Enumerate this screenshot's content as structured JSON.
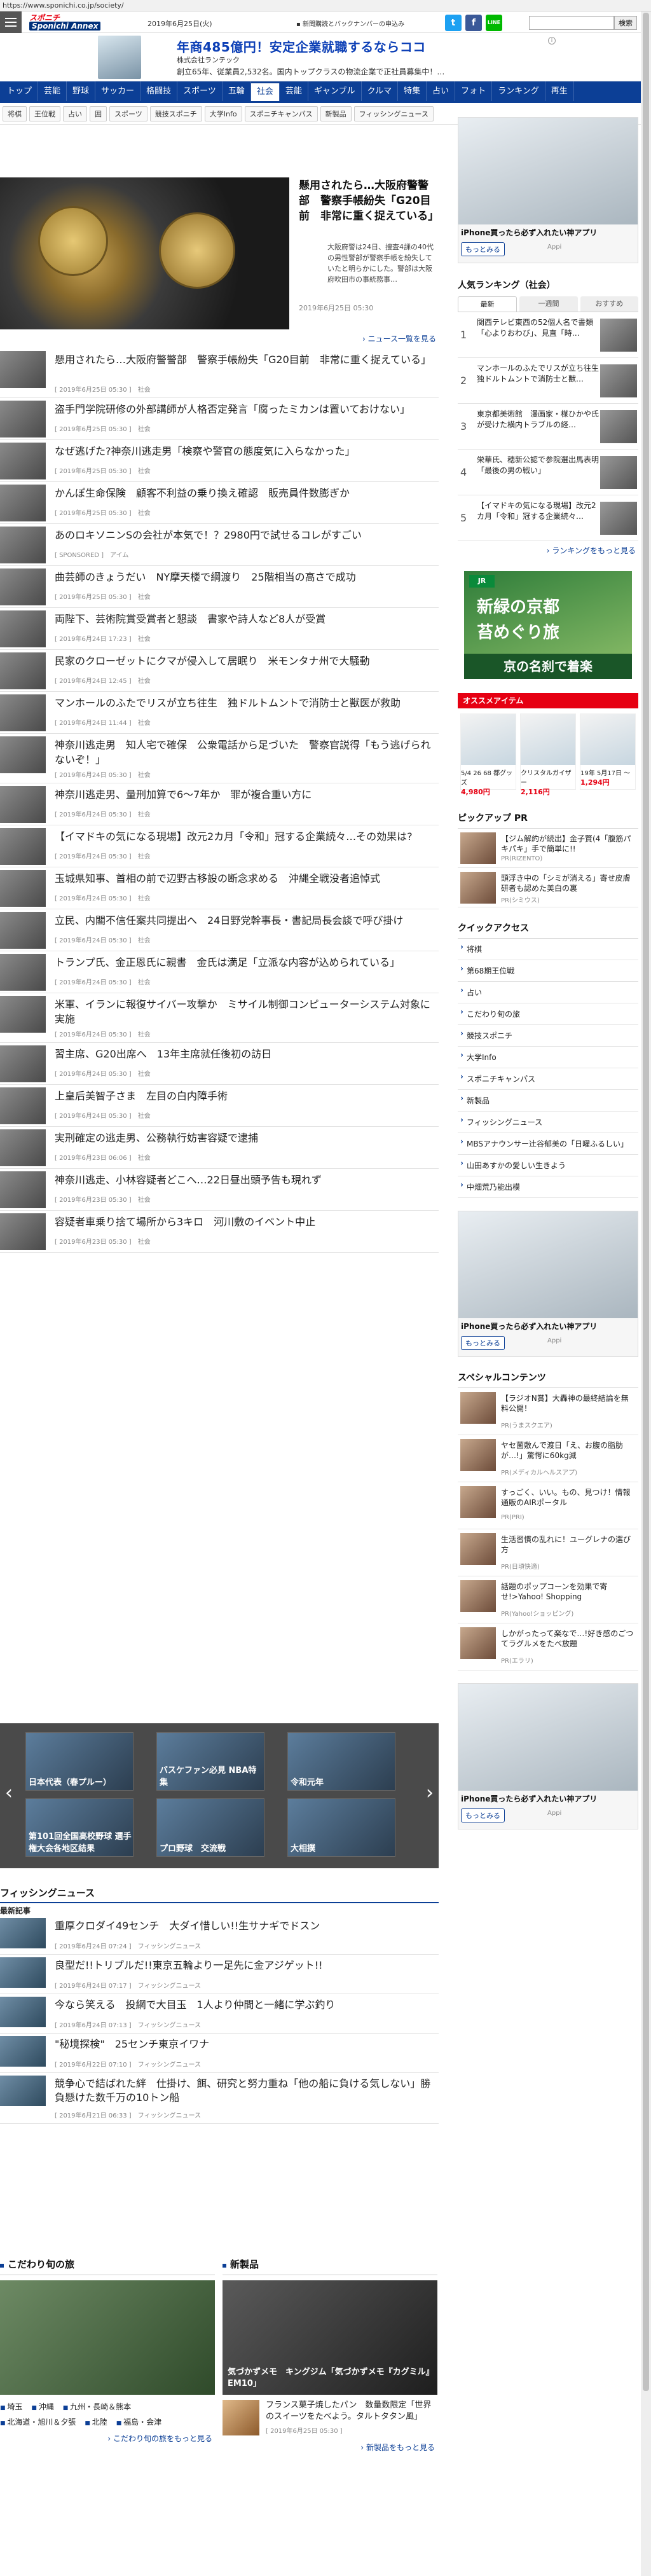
{
  "browser": {
    "url": "https://www.sponichi.co.jp/society/"
  },
  "header": {
    "logo_line1": "スポニチ",
    "logo_line2": "Sponichi Annex",
    "date": "2019年6月25日(火)",
    "subscribe": "新聞購読とバックナンバーの申込み",
    "search_button": "検索",
    "line_label": "LINE"
  },
  "top_ad": {
    "headline": "年商485億円！安定企業就職するならココ",
    "company": "株式会社ランテック",
    "body": "創立65年、従業員2,532名。国内トップクラスの物流企業で正社員募集中！…"
  },
  "nav": {
    "items": [
      "トップ",
      "芸能",
      "野球",
      "サッカー",
      "格闘技",
      "スポーツ",
      "五輪",
      "社会",
      "芸能",
      "ギャンブル",
      "クルマ",
      "特集",
      "占い",
      "フォト",
      "ランキング",
      "再生"
    ],
    "active_index": 7
  },
  "subnav": {
    "items": [
      "将棋",
      "王位戦",
      "占い",
      "囲",
      "スポーツ",
      "競技スポニチ",
      "大学Info",
      "スポニチキャンパス",
      "新製品",
      "フィッシングニュース"
    ]
  },
  "feature": {
    "title": "懸用されたら…大阪府警警部　警察手帳紛失「G20目前　非常に重く捉えている」",
    "desc": "大阪府警は24日、捜査4課の40代の男性警部が警察手帳を紛失していたと明らかにした。警部は大阪府吹田市の事統務事…",
    "date": "2019年6月25日 05:30",
    "more": "ニュース一覧を見る"
  },
  "articles": [
    {
      "title": "懸用されたら…大阪府警警部　警察手帳紛失「G20目前　非常に重く捉えている」",
      "meta": "[ 2019年6月25日 05:30 ]　社会"
    },
    {
      "title": "盗手門学院研修の外部講師が人格否定発言「腐ったミカンは置いておけない」",
      "meta": "[ 2019年6月25日 05:30 ]　社会"
    },
    {
      "title": "なぜ逃げた?神奈川逃走男「検察や警官の態度気に入らなかった」",
      "meta": "[ 2019年6月25日 05:30 ]　社会"
    },
    {
      "title": "かんぽ生命保険　顧客不利益の乗り換え確認　販売員件数膨ぎか",
      "meta": "[ 2019年6月25日 05:30 ]　社会"
    },
    {
      "title": "あのロキソニンSの会社が本気で！？2980円で試せるコレがすごい",
      "meta": "[ SPONSORED ]　アイム"
    },
    {
      "title": "曲芸師のきょうだい　NY摩天楼で綱渡り　25階相当の高さで成功",
      "meta": "[ 2019年6月25日 05:30 ]　社会"
    },
    {
      "title": "両陛下、芸術院賞受賞者と懇談　書家や詩人など8人が受賞",
      "meta": "[ 2019年6月24日 17:23 ]　社会"
    },
    {
      "title": "民家のクローゼットにクマが侵入して居眠り　米モンタナ州で大騒動",
      "meta": "[ 2019年6月24日 12:45 ]　社会"
    },
    {
      "title": "マンホールのふたでリスが立ち往生　独ドルトムントで消防士と獣医が救助",
      "meta": "[ 2019年6月24日 11:44 ]　社会"
    },
    {
      "title": "神奈川逃走男　知人宅で確保　公衆電話から足づいた　警察官説得「もう逃げられないぞ！」",
      "meta": "[ 2019年6月24日 05:30 ]　社会"
    },
    {
      "title": "神奈川逃走男、量刑加算で6～7年か　罪が複合重い方に",
      "meta": "[ 2019年6月24日 05:30 ]　社会"
    },
    {
      "title": "【イマドキの気になる現場】改元2カ月「令和」冠する企業続々…その効果は?",
      "meta": "[ 2019年6月24日 05:30 ]　社会"
    },
    {
      "title": "玉城県知事、首相の前で辺野古移設の断念求める　沖縄全戦没者追悼式",
      "meta": "[ 2019年6月24日 05:30 ]　社会"
    },
    {
      "title": "立民、内閣不信任案共同提出へ　24日野党幹事長・書記局長会談で呼び掛け",
      "meta": "[ 2019年6月24日 05:30 ]　社会"
    },
    {
      "title": "トランプ氏、金正恩氏に親書　金氏は満足「立派な内容が込められている」",
      "meta": "[ 2019年6月24日 05:30 ]　社会"
    },
    {
      "title": "米軍、イランに報復サイバー攻撃か　ミサイル制御コンピューターシステム対象に実施",
      "meta": "[ 2019年6月24日 05:30 ]　社会"
    },
    {
      "title": "習主席、G20出席へ　13年主席就任後初の訪日",
      "meta": "[ 2019年6月24日 05:30 ]　社会"
    },
    {
      "title": "上皇后美智子さま　左目の白内障手術",
      "meta": "[ 2019年6月24日 05:30 ]　社会"
    },
    {
      "title": "実刑確定の逃走男、公務執行妨害容疑で逮捕",
      "meta": "[ 2019年6月23日 06:06 ]　社会"
    },
    {
      "title": "神奈川逃走、小林容疑者どこへ…22日昼出頭予告も現れず",
      "meta": "[ 2019年6月23日 05:30 ]　社会"
    },
    {
      "title": "容疑者車乗り捨て場所から3キロ　河川敷のイベント中止",
      "meta": "[ 2019年6月23日 05:30 ]　社会"
    }
  ],
  "slider": {
    "tiles": [
      "日本代表（春プルー）",
      "バスケファン必見 NBA特集",
      "令和元年",
      "第101回全国高校野球 選手権大会各地区結果",
      "プロ野球　交流戦",
      "大相撲"
    ]
  },
  "fishing": {
    "title": "フィッシングニュース",
    "subtitle": "最新記事",
    "items": [
      {
        "title": "重厚クロダイ49センチ　大ダイ惜しい!!生サナギでドスン",
        "meta": "[ 2019年6月24日 07:24 ]　フィッシングニュース"
      },
      {
        "title": "良型だ!!トリプルだ!!東京五輪より一足先に金アジゲット!!",
        "meta": "[ 2019年6月24日 07:17 ]　フィッシングニュース"
      },
      {
        "title": "今なら笑える　投網で大目玉　1人より仲間と一緒に学ぶ釣り",
        "meta": "[ 2019年6月24日 07:13 ]　フィッシングニュース"
      },
      {
        "title": "\"秘境探検\"　25センチ東京イワナ",
        "meta": "[ 2019年6月22日 07:10 ]　フィッシングニュース"
      },
      {
        "title": "競争心で結ばれた絆　仕掛け、餌、研究と努力重ね「他の船に負ける気しない」勝負懸けた数千万の10トン船",
        "meta": "[ 2019年6月21日 06:33 ]　フィッシングニュース"
      }
    ]
  },
  "kodawari": {
    "title": "こだわり旬の旅",
    "links": [
      "埼玉",
      "沖縄",
      "九州・長崎＆熊本",
      "北海道・旭川＆夕張",
      "北陸",
      "福島・会津"
    ],
    "more": "こだわり旬の旅をもっと見る"
  },
  "shinseihin": {
    "title": "新製品",
    "img_caption": "気づかずメモ　キングジム「気づかずメモ『カグミル』EM10」",
    "item_title": "フランス菓子焼したパン　数量数限定「世界のスイーツをたべよう。タルトタタン風」",
    "item_date": "[ 2019年6月25日 05:30 ]",
    "more": "新製品をもっと見る"
  },
  "side": {
    "ad_title": "iPhone買ったら必ず入れたい神アプリ",
    "ad_button": "もっとみる",
    "ad_source": "Appi",
    "ranking_title": "人気ランキング（社会）",
    "ranking_tabs": [
      "最新",
      "一週間",
      "おすすめ"
    ],
    "ranking": [
      {
        "n": "1",
        "t": "関西テレビ東西の52個人名で書類「心よりおわび」、見直「時…"
      },
      {
        "n": "2",
        "t": "マンホールのふたでリスが立ち往生　独ドルトムントで消防士と獣…"
      },
      {
        "n": "3",
        "t": "東京都美術館　漫画家・楳ひかや氏が受けた横内トラブルの経…"
      },
      {
        "n": "4",
        "t": "栄華氏、穂新公認で参院選出馬表明「最後の男の戦い」"
      },
      {
        "n": "5",
        "t": "【イマドキの気になる現場】改元2カ月「令和」冠する企業続々…"
      }
    ],
    "ranking_more": "ランキングをもっと見る",
    "jr_ad": {
      "t1": "新緑の京都",
      "t2": "苔めぐり旅",
      "t3": "京の名刹で着楽"
    },
    "osusume_title": "オススメアイテム",
    "osusume_items": [
      {
        "label": "5/4 26 68 都グッズ",
        "price": "4,980円"
      },
      {
        "label": "クリスタルガイザー",
        "price": "2,116円"
      },
      {
        "label": "19年 5月17日 ～",
        "price": "1,294円"
      }
    ],
    "pickup_title": "ピックアップ PR",
    "pickup": [
      {
        "t": "【ジム解約が続出】金子賢(4「腹筋パキパキ」手で簡単に!!",
        "s": "PR(RIZENTO)"
      },
      {
        "t": "頭浮き中の「シミが消える」寄せ皮膚研者も認めた美白の裏",
        "s": "PR(シミウス)"
      }
    ],
    "quick_title": "クイックアクセス",
    "quick": [
      "将棋",
      "第68期王位戦",
      "占い",
      "こだわり旬の旅",
      "競技スポニチ",
      "大学Info",
      "スポニチキャンパス",
      "新製品",
      "フィッシングニュース",
      "MBSアナウンサー辻谷郁美の「日曜ふるしい」",
      "山田あすかの愛しい生きよう",
      "中畑荒乃能出模"
    ],
    "special_title": "スペシャルコンテンツ",
    "special": [
      {
        "t": "【ラジオN賞】大轟神の最終結論を無料公開！",
        "s": "PR(うまスクエア)"
      },
      {
        "t": "ヤセ菌敷んで渡日「え、お腹の脂肪が…!」驚愕に60kg減",
        "s": "PR(メディカルヘルスアプ)"
      },
      {
        "t": "すっごく、いい。もの、見つけ！情報通販のAIRポータル",
        "s": "PR(PRI)"
      },
      {
        "t": "生活習慣の乱れに！ユーグレナの選び方",
        "s": "PR(日頃快適)"
      },
      {
        "t": "話題のポップコーンを効果で寄せ!>Yahoo! Shopping",
        "s": "PR(Yahoo!ショッピング)"
      },
      {
        "t": "しかがったって楽なで…!好き感のごつてラグルメをたべ放題",
        "s": "PR(エラリ)"
      }
    ]
  }
}
